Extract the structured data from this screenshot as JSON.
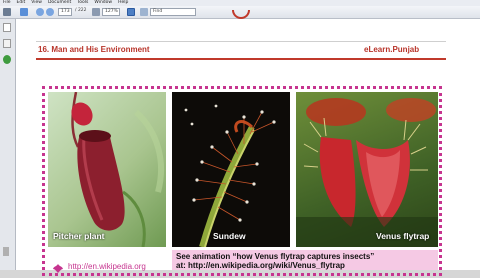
{
  "menubar": [
    "File",
    "Edit",
    "View",
    "Document",
    "Tools",
    "Window",
    "Help"
  ],
  "toolbar": {
    "page_field": "173",
    "page_total": "/ 222",
    "zoom": "127%",
    "find_placeholder": "Find"
  },
  "header": {
    "left": "16.  Man and His Environment",
    "right": "eLearn.Punjab"
  },
  "captions": {
    "pitcher": "Pitcher plant",
    "sundew": "Sundew",
    "venus": "Venus flytrap"
  },
  "note": {
    "line1": "See animation “how Venus flytrap captures insects”",
    "line2": "at: http://en.wikipedia.org/wiki/Venus_flytrap"
  },
  "link": "http://en.wikipedia.org",
  "colors": {
    "accent": "#c6348f",
    "header_red": "#b8342a",
    "note_bg": "#f5c9e4"
  }
}
